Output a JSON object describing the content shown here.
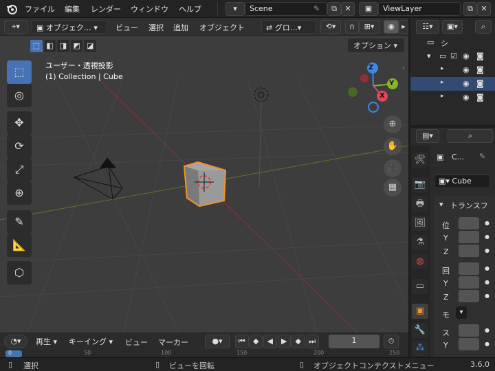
{
  "topbar": {
    "menus": [
      "ファイル",
      "編集",
      "レンダー",
      "ウィンドウ",
      "ヘルプ"
    ],
    "scene": "Scene",
    "view_layer": "ViewLayer"
  },
  "viewport_header": {
    "mode": "オブジェク…",
    "menus": [
      "ビュー",
      "選択",
      "追加",
      "オブジェクト"
    ],
    "orientation": "グロ…",
    "options": "オプション"
  },
  "viewport": {
    "view_name": "ユーザー・透視投影",
    "collection_info": "(1) Collection | Cube",
    "gizmo": {
      "z": "Z",
      "y": "Y",
      "x": "X"
    }
  },
  "timeline": {
    "playback": "再生",
    "keying": "キーイング",
    "view": "ビュー",
    "marker": "マーカー",
    "current_frame": "1",
    "ruler_ticks": [
      "0",
      "50",
      "100",
      "150",
      "200",
      "250"
    ]
  },
  "status": {
    "left_action": "選択",
    "middle_action": "ビューを回転",
    "right_action": "オブジェクトコンテクストメニュー",
    "version": "3.6.0"
  },
  "outliner": {
    "scene_label": "シ"
  },
  "properties": {
    "object_short": "C...",
    "object_name": "Cube",
    "panel_title": "トランスフ",
    "location_label": "位",
    "rotation_label": "回",
    "mode_label": "モ",
    "scale_label": "ス",
    "axis_y": "Y",
    "axis_z": "Z"
  },
  "colors": {
    "accent_selected": "#4772b3",
    "object_outline": "#f0902a",
    "axis_x": "#e0475a",
    "axis_y": "#87b32d",
    "axis_z": "#3d8ae0"
  }
}
